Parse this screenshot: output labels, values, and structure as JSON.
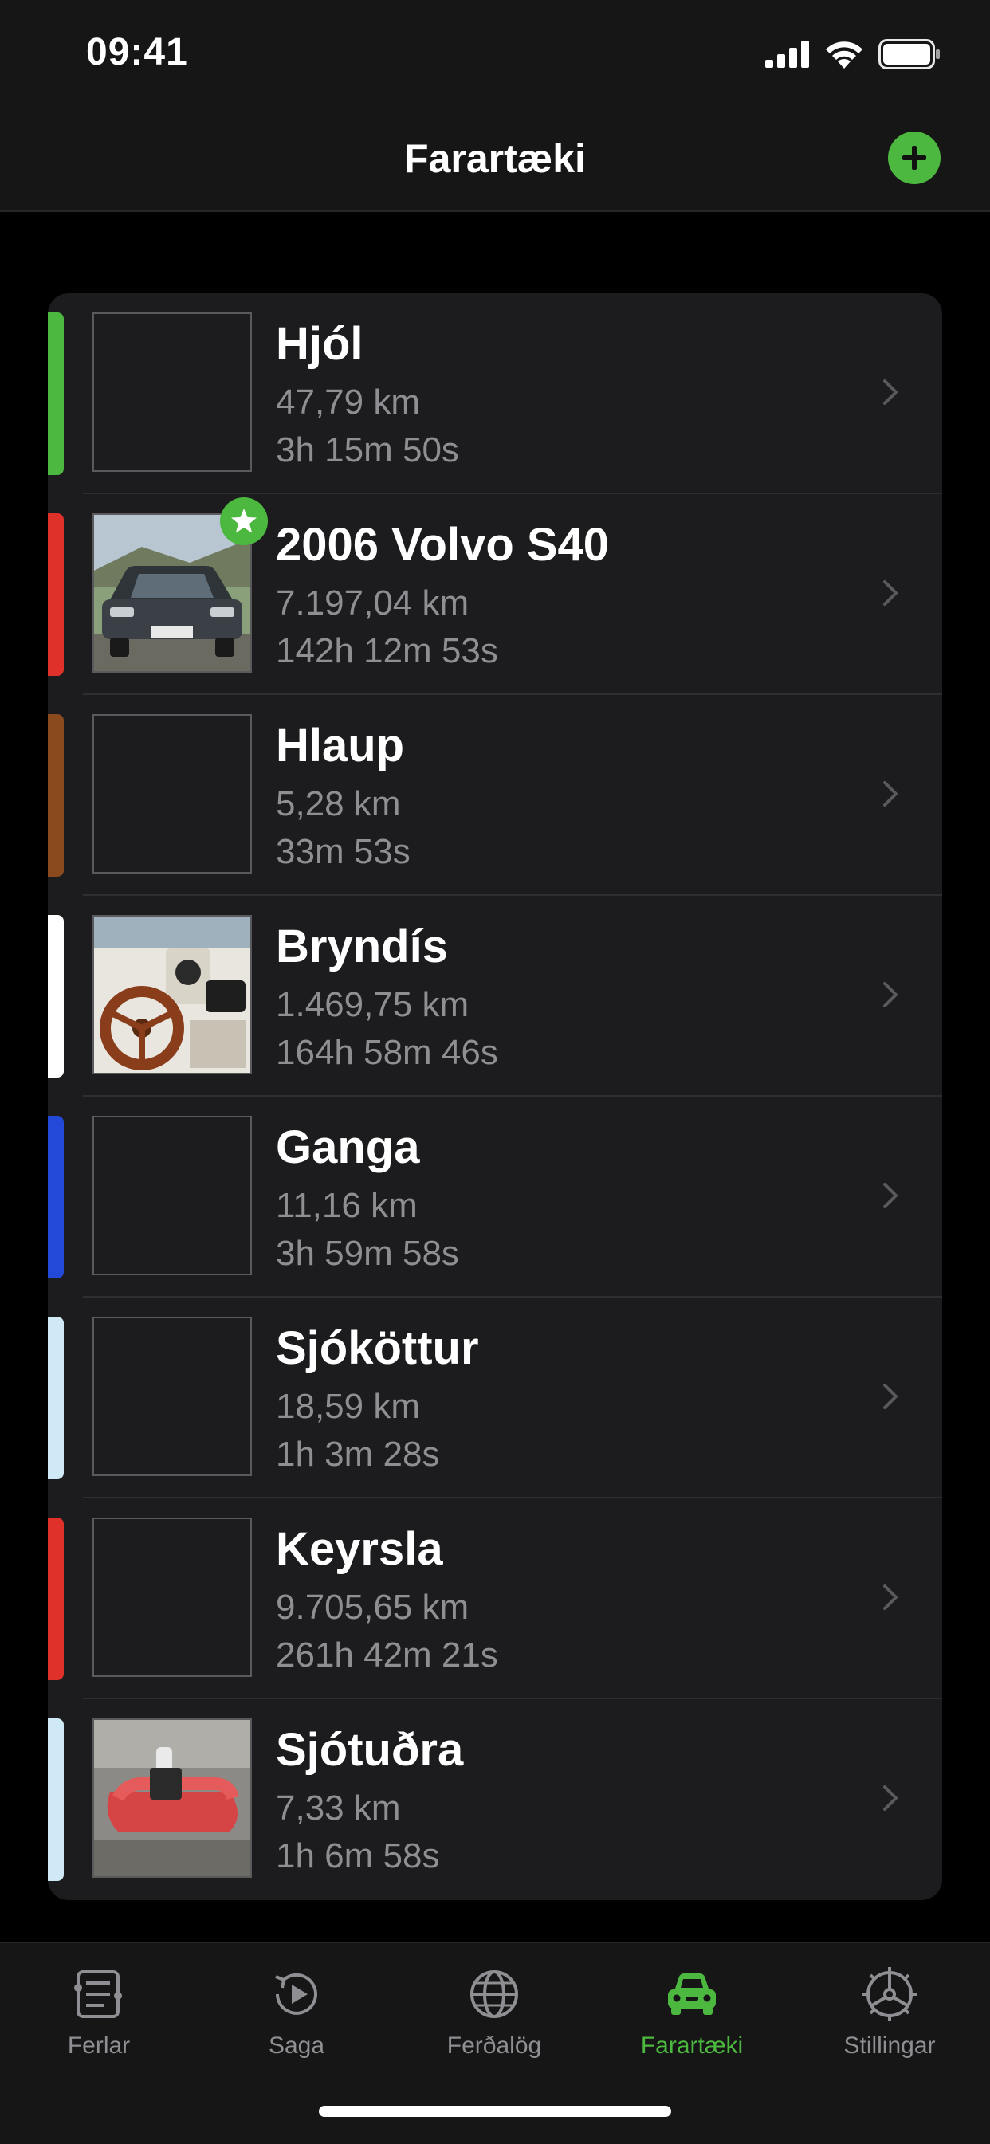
{
  "status": {
    "time": "09:41"
  },
  "nav": {
    "title": "Farartæki",
    "add_icon": "plus-circle-icon"
  },
  "vehicles": [
    {
      "name": "Hjól",
      "distance": "47,79 km",
      "duration": "3h 15m 50s",
      "color": "#4cb83f",
      "photo": ""
    },
    {
      "name": "2006 Volvo S40",
      "distance": "7.197,04 km",
      "duration": "142h 12m 53s",
      "color": "#e0302a",
      "photo": "car-photo",
      "favorite": true
    },
    {
      "name": "Hlaup",
      "distance": "5,28 km",
      "duration": "33m 53s",
      "color": "#8a4a1e",
      "photo": ""
    },
    {
      "name": "Bryndís",
      "distance": "1.469,75 km",
      "duration": "164h 58m 46s",
      "color": "#ffffff",
      "photo": "boat-dashboard-photo"
    },
    {
      "name": "Ganga",
      "distance": "11,16 km",
      "duration": "3h 59m 58s",
      "color": "#2349d8",
      "photo": ""
    },
    {
      "name": "Sjóköttur",
      "distance": "18,59 km",
      "duration": "1h 3m 28s",
      "color": "#cfe9f7",
      "photo": ""
    },
    {
      "name": "Keyrsla",
      "distance": "9.705,65 km",
      "duration": "261h 42m 21s",
      "color": "#e0302a",
      "photo": ""
    },
    {
      "name": "Sjótuðra",
      "distance": "7,33 km",
      "duration": "1h 6m 58s",
      "color": "#cfe9f7",
      "photo": "inflatable-boat-photo"
    }
  ],
  "tabs": [
    {
      "label": "Ferlar",
      "icon": "list-icon"
    },
    {
      "label": "Saga",
      "icon": "history-play-icon"
    },
    {
      "label": "Ferðalög",
      "icon": "globe-icon"
    },
    {
      "label": "Farartæki",
      "icon": "car-icon",
      "active": true
    },
    {
      "label": "Stillingar",
      "icon": "settings-wheel-icon"
    }
  ],
  "colors": {
    "accent": "#4cb83f",
    "secondary_text": "#8e8e93",
    "card": "#1c1c1e"
  }
}
